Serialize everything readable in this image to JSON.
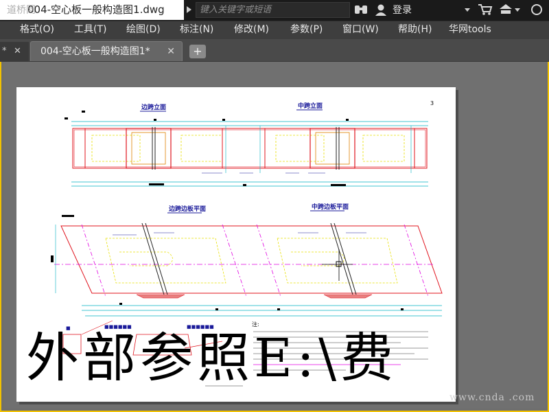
{
  "title_bar": {
    "watermark": "道桥网",
    "file_title": "004-空心板一般构造图1.dwg",
    "search_placeholder": "键入关键字或短语",
    "login_label": "登录"
  },
  "menu": {
    "items": [
      "格式(O)",
      "工具(T)",
      "绘图(D)",
      "标注(N)",
      "修改(M)",
      "参数(P)",
      "窗口(W)",
      "帮助(H)",
      "华网tools"
    ]
  },
  "tabs": {
    "previous_tab_label": "*",
    "active_tab_label": "004-空心板一般构造图1*",
    "add_tab_label": "+"
  },
  "drawing": {
    "title_side_span_elevation": "边跨立面",
    "title_mid_span_elevation": "中跨立面",
    "title_side_span_plan": "边跨边板平面",
    "title_mid_span_plan": "中跨边板平面",
    "page_number": "3",
    "notes_title": "注:"
  },
  "overlay": {
    "xref_message": "外部参照E:\\费",
    "bottom_watermark": "www.cnda .com"
  },
  "icons": {
    "binoculars": "binoculars-icon",
    "user": "user-icon",
    "cart": "cart-icon",
    "exchange": "exchange-icon"
  }
}
